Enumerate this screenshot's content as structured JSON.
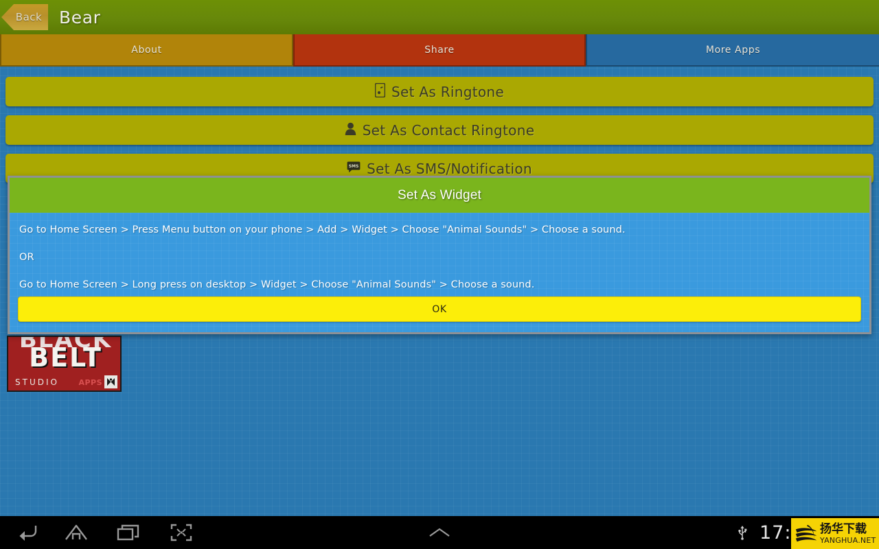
{
  "header": {
    "back_label": "Back",
    "title": "Bear"
  },
  "tabs": [
    {
      "id": "about",
      "label": "About",
      "color": "#b1840a",
      "selected": false
    },
    {
      "id": "share",
      "label": "Share",
      "color": "#b2330e",
      "selected": true
    },
    {
      "id": "more-apps",
      "label": "More Apps",
      "color": "#26699f",
      "selected": false
    }
  ],
  "actions": [
    {
      "id": "ringtone",
      "label": "Set As Ringtone",
      "icon": "phone-music-icon"
    },
    {
      "id": "contact-ringtone",
      "label": "Set As Contact Ringtone",
      "icon": "person-icon"
    },
    {
      "id": "sms-notification",
      "label": "Set As SMS/Notification",
      "icon": "sms-bubble-icon"
    }
  ],
  "dialog": {
    "title": "Set As Widget",
    "line1": "Go to Home Screen > Press Menu button on your phone > Add > Widget > Choose \"Animal Sounds\" > Choose a sound.",
    "line2": "OR",
    "line3": "Go to Home Screen > Long press on desktop > Widget > Choose \"Animal Sounds\" > Choose a sound.",
    "ok_label": "OK"
  },
  "logo": {
    "top_word": "BLACK",
    "main_word": "BELT",
    "sub_word": "STUDIO",
    "apps_word": "APPS"
  },
  "navbar": {
    "back": "back-icon",
    "home": "home-icon",
    "recents": "recents-icon",
    "screenshot": "screenshot-icon",
    "expand": "chevron-up-icon",
    "usb": "usb-icon",
    "clock": "17:"
  },
  "watermark": {
    "cn": "扬华下载",
    "en": "YANGHUA.NET"
  },
  "colors": {
    "background": "#2a78b0",
    "header_green": "#67880a",
    "button_olive": "#aaa802",
    "dialog_title_green": "#7ab51d",
    "dialog_body_blue": "#3a9ade",
    "ok_yellow": "#fcee09",
    "tab_selected_red": "#b2330e"
  }
}
